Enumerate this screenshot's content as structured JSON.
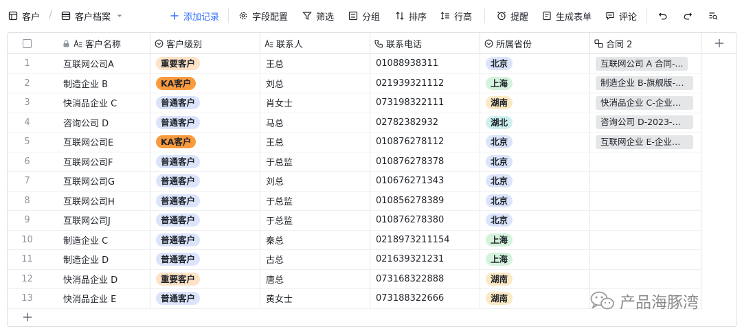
{
  "toolbar": {
    "table_name": "客户",
    "view_name": "客户档案",
    "add_record": "添加记录",
    "field_config": "字段配置",
    "filter": "筛选",
    "group": "分组",
    "sort": "排序",
    "row_height": "行高",
    "remind": "提醒",
    "generate_form": "生成表单",
    "comment": "评论"
  },
  "columns": {
    "name": "客户名称",
    "level": "客户级别",
    "contact": "联系人",
    "phone": "联系电话",
    "province": "所属省份",
    "contract": "合同 2"
  },
  "colors": {
    "level_important_bg": "#fde2c6",
    "level_ka_bg": "#f99a3d",
    "level_normal_bg": "#dbe4fb",
    "prov_beijing_bg": "#dbe4fb",
    "prov_shanghai_bg": "#d4f2dc",
    "prov_hunan_bg": "#fbe9c3",
    "prov_hubei_bg": "#cdf0ee"
  },
  "rows": [
    {
      "idx": "1",
      "name": "互联网公司A",
      "level": "重要客户",
      "contact": "王总",
      "phone": "01088938311",
      "province": "北京",
      "contract": "互联网公司 A 合同-..."
    },
    {
      "idx": "2",
      "name": "制造企业 B",
      "level": "KA客户",
      "contact": "刘总",
      "phone": "021939321112",
      "province": "上海",
      "contract": "制造企业 B-旗舰版-0..."
    },
    {
      "idx": "3",
      "name": "快消品企业 C",
      "level": "普通客户",
      "contact": "肖女士",
      "phone": "073198322111",
      "province": "湖南",
      "contract": "快消品企业 C-企业版..."
    },
    {
      "idx": "4",
      "name": "咨询公司 D",
      "level": "普通客户",
      "contact": "马总",
      "phone": "02782382932",
      "province": "湖北",
      "contract": "咨询公司 D-2023-标..."
    },
    {
      "idx": "5",
      "name": "互联网公司E",
      "level": "KA客户",
      "contact": "王总",
      "phone": "010876278112",
      "province": "北京",
      "contract": "互联网企业 E-企业版..."
    },
    {
      "idx": "6",
      "name": "互联网公司F",
      "level": "普通客户",
      "contact": "于总监",
      "phone": "010876278378",
      "province": "北京",
      "contract": ""
    },
    {
      "idx": "7",
      "name": "互联网公司G",
      "level": "普通客户",
      "contact": "刘总",
      "phone": "010676271343",
      "province": "北京",
      "contract": ""
    },
    {
      "idx": "8",
      "name": "互联网公司H",
      "level": "普通客户",
      "contact": "于总监",
      "phone": "010856278389",
      "province": "北京",
      "contract": ""
    },
    {
      "idx": "9",
      "name": "互联网公司J",
      "level": "普通客户",
      "contact": "于总监",
      "phone": "010876278380",
      "province": "北京",
      "contract": ""
    },
    {
      "idx": "10",
      "name": "制造企业 C",
      "level": "普通客户",
      "contact": "秦总",
      "phone": "0218973211154",
      "province": "上海",
      "contract": ""
    },
    {
      "idx": "11",
      "name": "制造企业 D",
      "level": "普通客户",
      "contact": "古总",
      "phone": "021639321231",
      "province": "上海",
      "contract": ""
    },
    {
      "idx": "12",
      "name": "快消品企业 D",
      "level": "重要客户",
      "contact": "唐总",
      "phone": "073168322888",
      "province": "湖南",
      "contract": ""
    },
    {
      "idx": "13",
      "name": "快消品企业 E",
      "level": "普通客户",
      "contact": "黄女士",
      "phone": "073188322666",
      "province": "湖南",
      "contract": ""
    }
  ],
  "watermark": "产品海豚湾"
}
